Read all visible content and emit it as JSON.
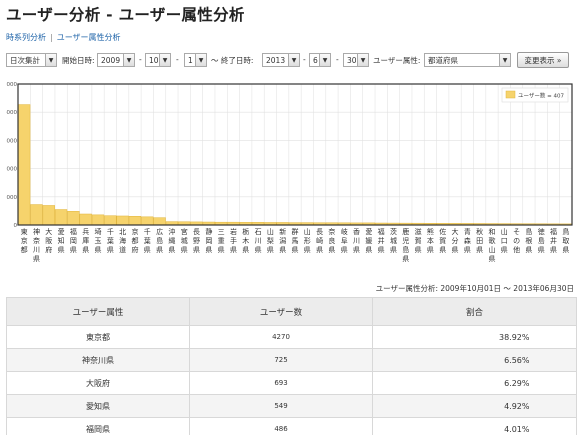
{
  "title": "ユーザー分析 - ユーザー属性分析",
  "subnav": {
    "link1": "時系列分析",
    "sep": "|",
    "link2": "ユーザー属性分析"
  },
  "controls": {
    "granularity": "日次集計",
    "start_label": "開始日時:",
    "start_year": "2009",
    "start_month": "10",
    "start_day": "1",
    "range_sep": "～ 終了日時:",
    "end_year": "2013",
    "end_month": "6",
    "end_day": "30",
    "dash": "-",
    "attr_label": "ユーザー属性:",
    "attr_value": "都道府県",
    "apply_button": "変更表示 »"
  },
  "chart_data": {
    "type": "bar",
    "ylim": [
      0,
      5000
    ],
    "yticks": [
      "0",
      "1000",
      "2000",
      "3000",
      "4000",
      "5000"
    ],
    "grid": true,
    "legend_position": "top-right",
    "series": [
      {
        "name": "ユーザー数 = 407",
        "color": "#f6d36c"
      }
    ],
    "categories": [
      "東京都",
      "神奈川県",
      "大阪府",
      "愛知県",
      "福岡県",
      "兵庫県",
      "埼玉県",
      "千葉県",
      "北海道",
      "京都府",
      "千葉県",
      "広島県",
      "沖縄県",
      "宮城県",
      "長野県",
      "静岡県",
      "三重県",
      "岩手県",
      "栃木県",
      "石川県",
      "山梨県",
      "新潟県",
      "群馬県",
      "山形県",
      "長崎県",
      "奈良県",
      "岐阜県",
      "香川県",
      "愛媛県",
      "福井県",
      "茨城県",
      "鹿児島県",
      "滋賀県",
      "熊本県",
      "佐賀県",
      "大分県",
      "青森県",
      "秋田県",
      "和歌山県",
      "山口県",
      "その他",
      "島根県",
      "徳島県",
      "福井県",
      "鳥取県"
    ],
    "values": [
      4270,
      725,
      693,
      549,
      486,
      390,
      360,
      330,
      320,
      310,
      290,
      260,
      120,
      115,
      110,
      105,
      100,
      100,
      95,
      95,
      90,
      90,
      85,
      85,
      80,
      80,
      78,
      75,
      75,
      70,
      68,
      66,
      64,
      62,
      60,
      58,
      56,
      54,
      52,
      50,
      48,
      46,
      44,
      42,
      40
    ]
  },
  "range_text": "ユーザー属性分析: 2009年10月01日 ～ 2013年06月30日",
  "table": {
    "headers": [
      "ユーザー属性",
      "ユーザー数",
      "割合"
    ],
    "rows": [
      {
        "attr": "東京都",
        "count": "4270",
        "ratio": "38.92%"
      },
      {
        "attr": "神奈川県",
        "count": "725",
        "ratio": "6.56%"
      },
      {
        "attr": "大阪府",
        "count": "693",
        "ratio": "6.29%"
      },
      {
        "attr": "愛知県",
        "count": "549",
        "ratio": "4.92%"
      },
      {
        "attr": "福岡県",
        "count": "486",
        "ratio": "4.01%"
      }
    ]
  }
}
